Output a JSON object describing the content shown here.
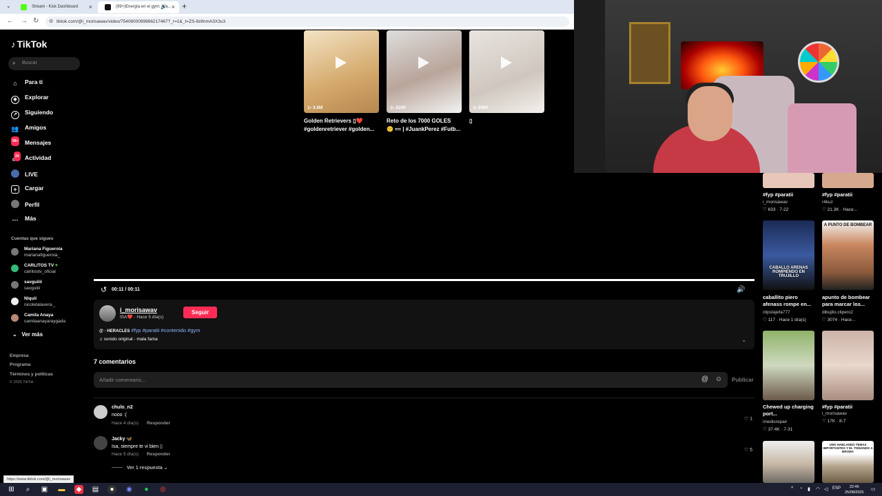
{
  "browser": {
    "tabs": [
      {
        "label": "Stream - Kick Dashboard",
        "favicon_color": "#53fc18"
      },
      {
        "label": "(99+)Energía en el gym: (Sa...",
        "favicon_color": "#111111"
      }
    ],
    "new_tab": "+",
    "url": "tiktok.com/@i_morisawav/video/7540800099866217467?_r=1&_t=ZS-8z8nmA3X3u3"
  },
  "sidebar": {
    "logo": "TikTok",
    "search_placeholder": "Buscar",
    "nav": [
      {
        "label": "Para ti",
        "icon": "home-icon"
      },
      {
        "label": "Explorar",
        "icon": "compass-icon"
      },
      {
        "label": "Siguiendo",
        "icon": "following-icon"
      },
      {
        "label": "Amigos",
        "icon": "friends-icon"
      },
      {
        "label": "Mensajes",
        "icon": "messages-icon",
        "badge": "99+"
      },
      {
        "label": "Actividad",
        "icon": "activity-icon",
        "badge": "24"
      },
      {
        "label": "LIVE",
        "icon": "live-icon"
      },
      {
        "label": "Cargar",
        "icon": "upload-icon"
      },
      {
        "label": "Perfil",
        "icon": "profile-icon"
      },
      {
        "label": "Más",
        "icon": "more-icon"
      }
    ],
    "following_title": "Cuentas que sigues",
    "following": [
      {
        "name": "Mariana Figueroia",
        "handle": "marianafigueroia_"
      },
      {
        "name": "CARLITOS TV",
        "handle": "carlitostv_oficial",
        "verified": "♥"
      },
      {
        "name": "savguiiii",
        "handle": "savguiiii"
      },
      {
        "name": "Niquii",
        "handle": "nicoletalavera._"
      },
      {
        "name": "Camila Anaya",
        "handle": "camilaanayaraygada"
      }
    ],
    "see_more": "Ver más",
    "footer_links": [
      "Empresa",
      "Programa",
      "Términos y políticas"
    ],
    "copyright": "© 2025 TikTok"
  },
  "related_top": [
    {
      "count": "3.5M",
      "title1": "Golden Retrievers ▯❤️",
      "title2": "#goldenretriever #golden..."
    },
    {
      "count": "319K",
      "title1": "Reto de los 7000 GOLES",
      "title2": "🙂 ≈≈ | #JuankPerez #Futb..."
    },
    {
      "count": "2360",
      "title1": "▯",
      "title2": ""
    }
  ],
  "player": {
    "time": "00:11 / 00:11"
  },
  "post": {
    "username": "i_morisawav",
    "meta": "ISA❤️ · Hace 5 día(s)",
    "follow_label": "Seguir",
    "caption_mention": "@ ◦ HERACLES",
    "caption_tags": "#fyp #paratii #contenido #gym",
    "sound": "♫ sonido original - mala fama"
  },
  "comments": {
    "count_label": "7 comentarios",
    "input_placeholder": "Añadir comentario...",
    "publish_label": "Publicar",
    "items": [
      {
        "user": "chulo_n2",
        "text": "nooo :(",
        "time": "Hace 4 día(s)",
        "reply": "Responder",
        "likes": "1"
      },
      {
        "user": "Jacky 🦋",
        "text": "Isa, siempre te vi bien ▯",
        "time": "Hace 5 día(s)",
        "reply": "Responder",
        "likes": "5"
      }
    ],
    "view_replies": "Ver 1 respuesta"
  },
  "grid": [
    {
      "title": "#fyp #paratii",
      "user": "i_morisawav",
      "stats": "♡ 633 · 7-22"
    },
    {
      "title": "#fyp #paratii",
      "user": "r4kuz",
      "stats": "♡ 21.3K · Hace..."
    },
    {
      "title": "caballito piero afenass rompe en...",
      "user": "clipsIajefa777",
      "stats": "♡ 117 · Hace 1 día(s)",
      "overlay": "CABALLO ARENAS ROMPIENDO EN TRUJILLO"
    },
    {
      "title": "apunto de bombear para marcar los...",
      "user": "dibujito.clipero2",
      "stats": "♡ 3074 · Hace...",
      "overlay": "A PUNTO DE BOMBEAR"
    },
    {
      "title": "Chewed up charging port...",
      "user": "imedicrepair",
      "stats": "♡ 37.4K · 7-31"
    },
    {
      "title": "#fyp #paratii",
      "user": "i_morisawav",
      "stats": "♡ 17K · 8-7"
    },
    {
      "title": "",
      "user": "",
      "stats": ""
    },
    {
      "title": "",
      "user": "",
      "stats": "",
      "overlay": "UNO HABLANDO TEMAS IMPORTANTES Y EL TOMANDO A BROMA"
    }
  ],
  "status_url": "https://www.tiktok.com/@i_morisawav",
  "taskbar": {
    "lang": "ESP",
    "time": "22:46",
    "date": "25/08/2025"
  },
  "colors": {
    "accent": "#fe2c55",
    "tag": "#8fb6ff"
  }
}
